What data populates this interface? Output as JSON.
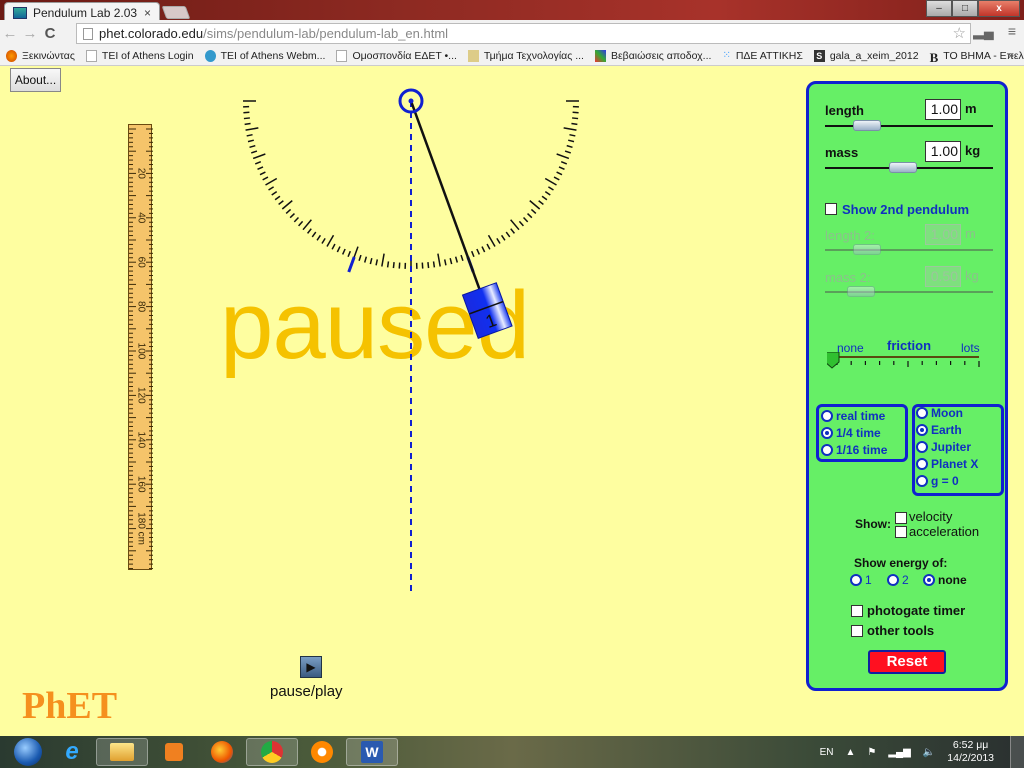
{
  "browser": {
    "tab_title": "Pendulum Lab 2.03",
    "tab_close": "×",
    "url_host": "phet.colorado.edu",
    "url_path": "/sims/pendulum-lab/pendulum-lab_en.html",
    "window_controls": {
      "minimize": "–",
      "maximize": "□",
      "close": "x"
    },
    "bookmarks": [
      {
        "label": "Ξεκινώντας",
        "icon": "firefox-icon"
      },
      {
        "label": "TEI of Athens Login",
        "icon": "page-icon"
      },
      {
        "label": "TEI of Athens Webm...",
        "icon": "globe-icon"
      },
      {
        "label": "Ομοσπονδία ΕΔΕΤ •...",
        "icon": "page-icon"
      },
      {
        "label": "Τμήμα Τεχνολογίας ...",
        "icon": "department-icon"
      },
      {
        "label": "Βεβαιώσεις αποδοχ...",
        "icon": "mosaic-icon"
      },
      {
        "label": "ΠΔΕ ΑΤΤΙΚΗΣ",
        "icon": "dots-icon"
      },
      {
        "label": "gala_a_xeim_2012",
        "icon": "s-icon"
      },
      {
        "label": "TO BHMA - Επελέγη...",
        "icon": "b-icon"
      }
    ],
    "bookmarks_more": "»"
  },
  "sim": {
    "about_label": "About...",
    "paused_label": "paused",
    "play_label": "pause/play",
    "logo": "PhET",
    "ruler": {
      "unit": "cm",
      "labels": [
        "20",
        "40",
        "60",
        "80",
        "100",
        "120",
        "140",
        "160",
        "180"
      ]
    },
    "pendulum": {
      "mass_label": "1",
      "angle_deg": 20
    }
  },
  "panel": {
    "length": {
      "label": "length",
      "value": "1.00",
      "unit": "m"
    },
    "mass": {
      "label": "mass",
      "value": "1.00",
      "unit": "kg"
    },
    "show2nd": {
      "label": "Show 2nd pendulum",
      "checked": false
    },
    "length2": {
      "label": "length 2:",
      "value": "1.00",
      "unit": "m"
    },
    "mass2": {
      "label": "mass 2:",
      "value": "0.50",
      "unit": "kg"
    },
    "friction": {
      "title": "friction",
      "min_label": "none",
      "max_label": "lots",
      "value": 0
    },
    "time_options": [
      {
        "label": "real time",
        "selected": false
      },
      {
        "label": "1/4 time",
        "selected": true
      },
      {
        "label": "1/16 time",
        "selected": false
      }
    ],
    "gravity_options": [
      {
        "label": "Moon",
        "selected": false
      },
      {
        "label": "Earth",
        "selected": true
      },
      {
        "label": "Jupiter",
        "selected": false
      },
      {
        "label": "Planet X",
        "selected": false
      },
      {
        "label": "g = 0",
        "selected": false
      }
    ],
    "show_label": "Show:",
    "velocity_label": "velocity",
    "acceleration_label": "acceleration",
    "energy_label": "Show energy of:",
    "energy_options": [
      {
        "label": "1",
        "selected": false
      },
      {
        "label": "2",
        "selected": false
      },
      {
        "label": "none",
        "selected": true
      }
    ],
    "photogate_label": "photogate timer",
    "other_tools_label": "other tools",
    "reset_label": "Reset"
  },
  "taskbar": {
    "apps": [
      "start-orb",
      "internet-explorer",
      "file-explorer",
      "media-player",
      "firefox",
      "chrome",
      "avast",
      "word"
    ],
    "lang": "EN",
    "time": "6:52 μμ",
    "date": "14/2/2013"
  }
}
